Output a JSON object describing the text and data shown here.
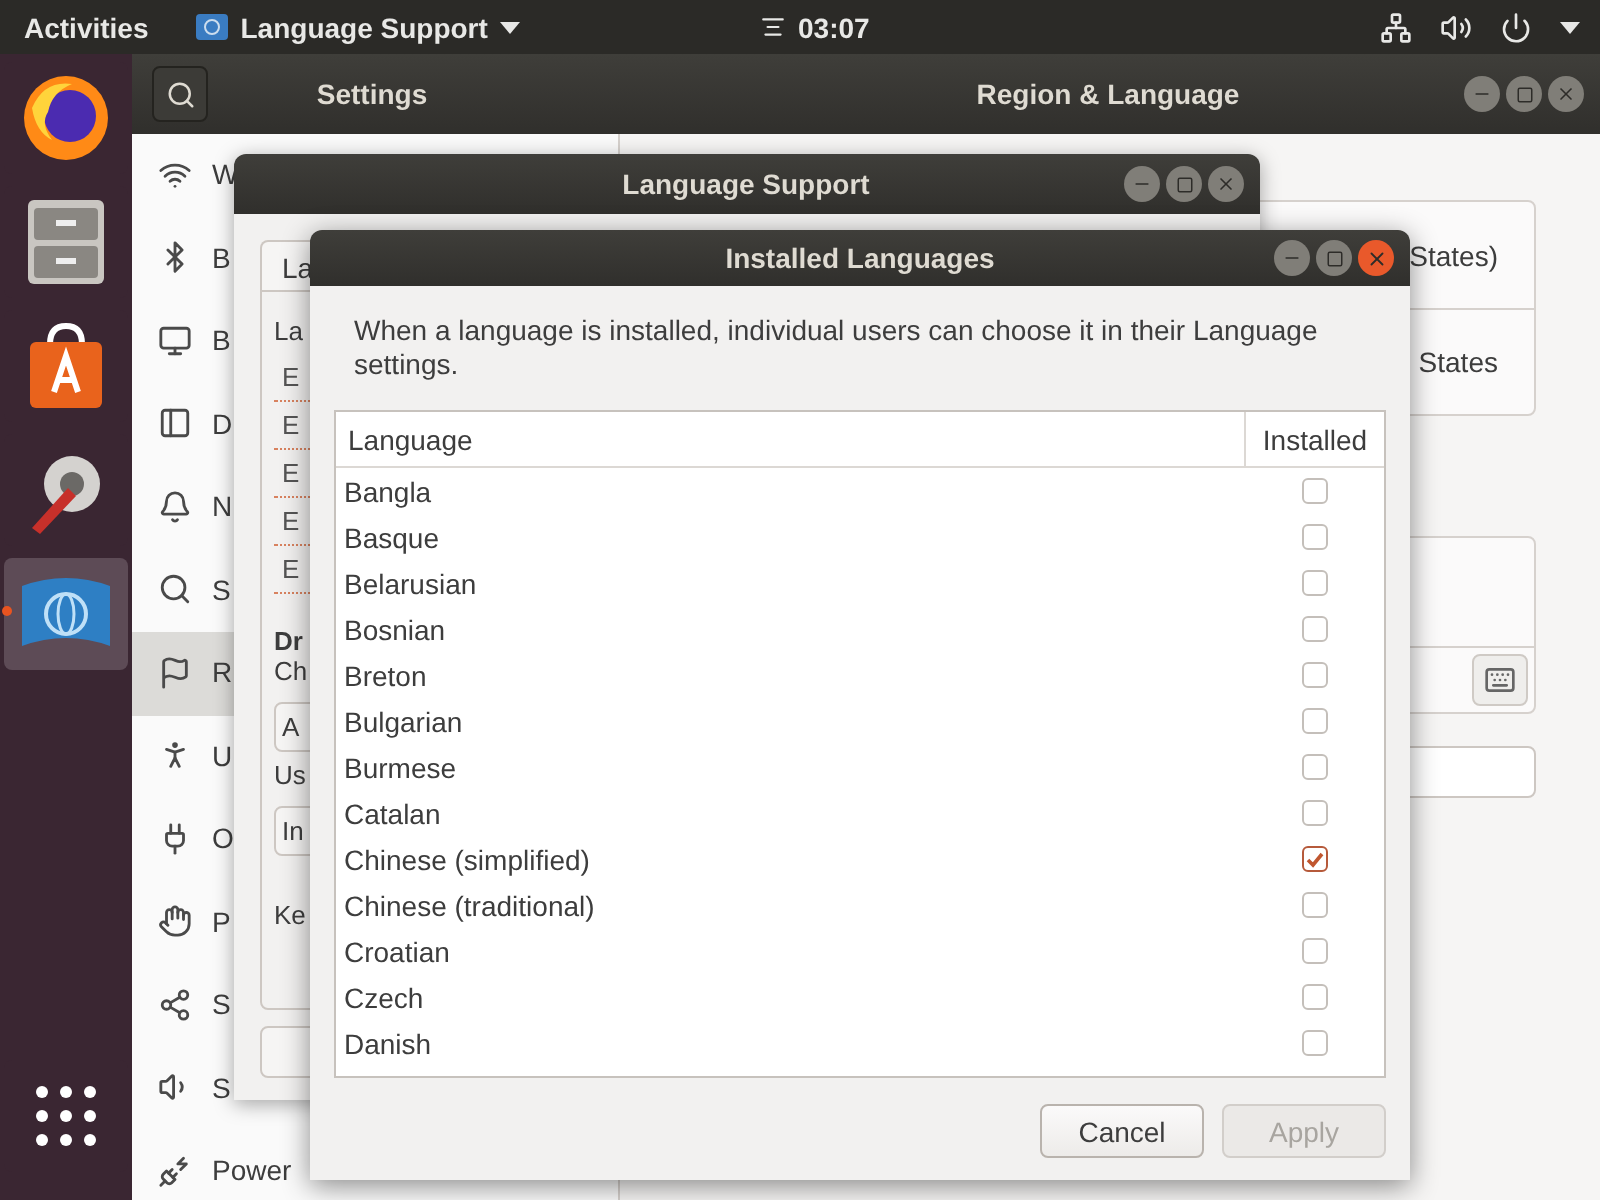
{
  "top_bar": {
    "activities": "Activities",
    "app_menu": "Language Support",
    "clock": "03:07"
  },
  "dock": [
    {
      "kind": "browser",
      "selected": false,
      "running": false
    },
    {
      "kind": "files",
      "selected": false,
      "running": false
    },
    {
      "kind": "store",
      "selected": false,
      "running": false
    },
    {
      "kind": "tools",
      "selected": false,
      "running": false
    },
    {
      "kind": "language",
      "selected": true,
      "running": true
    },
    {
      "kind": "grid",
      "selected": false,
      "running": false
    }
  ],
  "settings": {
    "title": "Settings",
    "panel_title": "Region & Language",
    "sidebar": [
      {
        "kind": "wifi",
        "label": "W",
        "selected": false
      },
      {
        "kind": "bluetooth",
        "label": "B",
        "selected": false
      },
      {
        "kind": "background",
        "label": "B",
        "selected": false
      },
      {
        "kind": "dock",
        "label": "D",
        "selected": false
      },
      {
        "kind": "bell",
        "label": "N",
        "selected": false
      },
      {
        "kind": "search",
        "label": "S",
        "selected": false
      },
      {
        "kind": "region",
        "label": "R",
        "selected": true
      },
      {
        "kind": "access",
        "label": "U",
        "selected": false
      },
      {
        "kind": "online",
        "label": "O",
        "selected": false
      },
      {
        "kind": "hand",
        "label": "P",
        "selected": false
      },
      {
        "kind": "share",
        "label": "S",
        "selected": false
      },
      {
        "kind": "sound",
        "label": "S",
        "selected": false
      },
      {
        "kind": "power",
        "label": "Power",
        "selected": false
      }
    ],
    "region_rows": [
      "States)",
      "States"
    ]
  },
  "language_support": {
    "title": "Language Support",
    "tab": "La",
    "heading": "La",
    "languages": [
      "E",
      "E",
      "E",
      "E",
      "E"
    ],
    "drop_title": "Dr",
    "drop_text": "Ch",
    "first_button": "A",
    "usage": "Us",
    "second_button": "In",
    "keyboard": "Ke"
  },
  "installed_dialog": {
    "title": "Installed Languages",
    "description": "When a language is installed, individual users can choose it in their Language settings.",
    "columns": [
      "Language",
      "Installed"
    ],
    "rows": [
      {
        "language": "Bangla",
        "installed": false
      },
      {
        "language": "Basque",
        "installed": false
      },
      {
        "language": "Belarusian",
        "installed": false
      },
      {
        "language": "Bosnian",
        "installed": false
      },
      {
        "language": "Breton",
        "installed": false
      },
      {
        "language": "Bulgarian",
        "installed": false
      },
      {
        "language": "Burmese",
        "installed": false
      },
      {
        "language": "Catalan",
        "installed": false
      },
      {
        "language": "Chinese (simplified)",
        "installed": true
      },
      {
        "language": "Chinese (traditional)",
        "installed": false
      },
      {
        "language": "Croatian",
        "installed": false
      },
      {
        "language": "Czech",
        "installed": false
      },
      {
        "language": "Danish",
        "installed": false
      }
    ],
    "buttons": [
      {
        "label": "Cancel",
        "disabled": false
      },
      {
        "label": "Apply",
        "disabled": true
      }
    ]
  }
}
